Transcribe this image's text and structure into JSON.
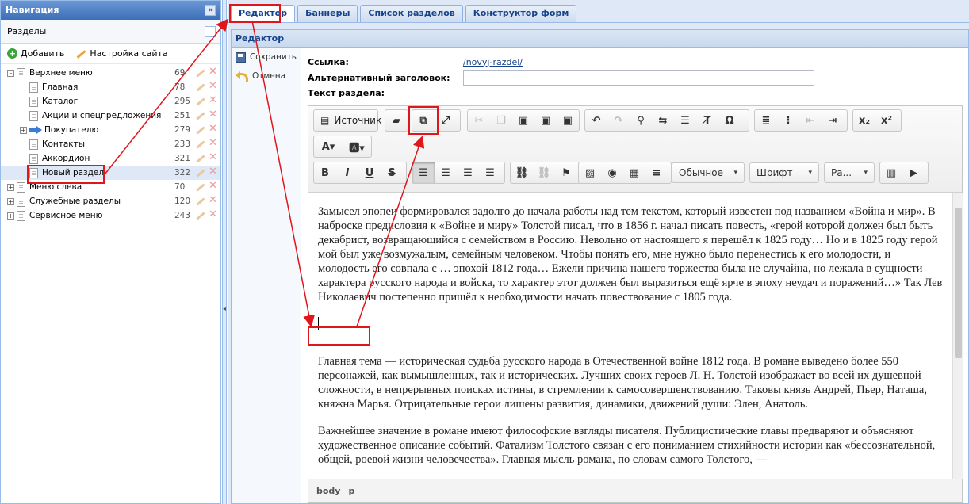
{
  "nav": {
    "title": "Навигация",
    "collapse_label": "«",
    "section_title": "Разделы",
    "tools": {
      "add": "Добавить",
      "site_settings": "Настройка сайта"
    },
    "tree": [
      {
        "label": "Верхнее меню",
        "count": "69",
        "level": 0,
        "expander": "–"
      },
      {
        "label": "Главная",
        "count": "78",
        "level": 1
      },
      {
        "label": "Каталог",
        "count": "295",
        "level": 1
      },
      {
        "label": "Акции и спецпредложения",
        "count": "251",
        "level": 1
      },
      {
        "label": "Покупателю",
        "count": "279",
        "level": 1,
        "expander": "+",
        "icon": "arrow"
      },
      {
        "label": "Контакты",
        "count": "233",
        "level": 1
      },
      {
        "label": "Аккордион",
        "count": "321",
        "level": 1
      },
      {
        "label": "Новый раздел",
        "count": "322",
        "level": 1,
        "selected": true
      },
      {
        "label": "Меню слева",
        "count": "70",
        "level": 0,
        "expander": "+"
      },
      {
        "label": "Служебные разделы",
        "count": "120",
        "level": 0,
        "expander": "+"
      },
      {
        "label": "Сервисное меню",
        "count": "243",
        "level": 0,
        "expander": "+"
      }
    ]
  },
  "tabs": [
    "Редактор",
    "Баннеры",
    "Список разделов",
    "Конструктор форм"
  ],
  "panel": {
    "title": "Редактор",
    "actions": {
      "save": "Сохранить",
      "cancel": "Отмена"
    }
  },
  "form": {
    "link_label": "Ссылка:",
    "link_value": "/novyj-razdel/",
    "alt_title_label": "Альтернативный заголовок:",
    "alt_title_value": "",
    "text_label": "Текст раздела:"
  },
  "editor": {
    "source_label": "Источник",
    "format_combo": "Обычное",
    "font_combo": "Шрифт",
    "size_combo": "Ра...",
    "paragraphs": [
      "Замысел эпопеи формировался задолго до начала работы над тем текстом, который известен под названием «Война и мир». В наброске предисловия к «Войне и миру» Толстой писал, что в 1856 г. начал писать повесть, «герой которой должен был быть декабрист, возвращающийся с семейством в Россию. Невольно от настоящего я перешёл к 1825 году… Но и в 1825 году герой мой был уже возмужалым, семейным человеком. Чтобы понять его, мне нужно было перенестись к его молодости, и молодость его совпала с … эпохой 1812 года… Ежели причина нашего торжества была не случайна, но лежала в сущности характера русского народа и войска, то характер этот должен был выразиться ещё ярче в эпоху неудач и поражений…» Так Лев Николаевич постепенно пришёл к необходимости начать повествование с 1805 года.",
      "Главная тема — историческая судьба русского народа в Отечественной войне 1812 года. В романе выведено более 550 персонажей, как вымышленных, так и исторических. Лучших своих героев Л. Н. Толстой изображает во всей их душевной сложности, в непрерывных поисках истины, в стремлении к самосовершенствованию. Таковы князь Андрей, Пьер, Наташа, княжна Марья. Отрицательные герои лишены развития, динамики, движений души: Элен, Анатоль.",
      "Важнейшее значение в романе имеют философские взгляды писателя. Публицистические главы предваряют и объясняют художественное описание событий. Фатализм Толстого связан с его пониманием стихийности истории как «бессознательной, общей, роевой жизни человечества». Главная мысль романа, по словам самого Толстого, —"
    ],
    "status_path": [
      "body",
      "p"
    ]
  },
  "colors": {
    "annotation": "#e0161b",
    "header_blue": "#3d6fb7",
    "link": "#15428b"
  }
}
